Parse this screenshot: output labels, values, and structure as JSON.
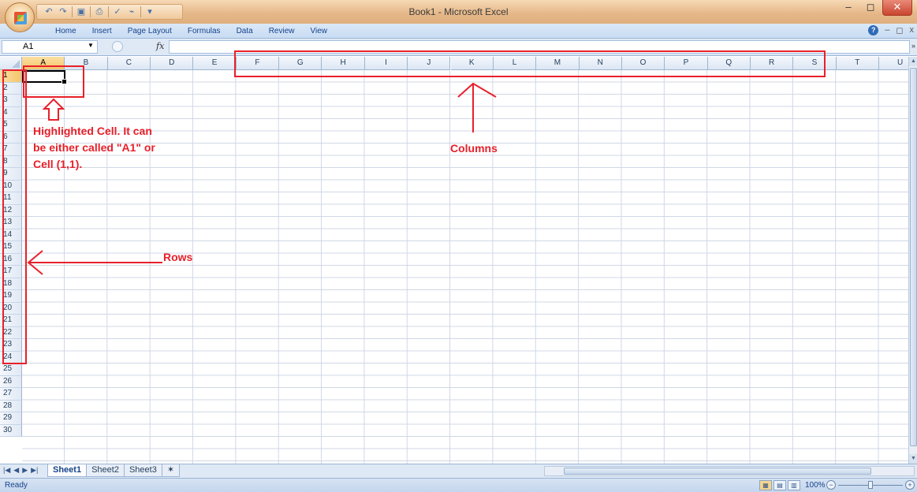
{
  "window": {
    "title": "Book1 - Microsoft Excel",
    "controls": [
      "–",
      "◻",
      "✕"
    ]
  },
  "ribbon": {
    "tabs": [
      "Home",
      "Insert",
      "Page Layout",
      "Formulas",
      "Data",
      "Review",
      "View"
    ],
    "right_controls": [
      "?",
      "–",
      "◻",
      "x"
    ]
  },
  "formula_bar": {
    "name_box": "A1",
    "fx_label": "fx",
    "formula_value": ""
  },
  "grid": {
    "columns": [
      "A",
      "B",
      "C",
      "D",
      "E",
      "F",
      "G",
      "H",
      "I",
      "J",
      "K",
      "L",
      "M",
      "N",
      "O",
      "P",
      "Q",
      "R",
      "S",
      "T",
      "U"
    ],
    "rows": [
      "1",
      "2",
      "3",
      "4",
      "5",
      "6",
      "7",
      "8",
      "9",
      "10",
      "11",
      "12",
      "13",
      "14",
      "15",
      "16",
      "17",
      "18",
      "19",
      "20",
      "21",
      "22",
      "23",
      "24",
      "25",
      "26",
      "27",
      "28",
      "29",
      "30"
    ],
    "active_column": "A",
    "active_row": "1"
  },
  "sheets": {
    "tabs": [
      "Sheet1",
      "Sheet2",
      "Sheet3"
    ],
    "active": "Sheet1"
  },
  "status": {
    "mode": "Ready",
    "zoom": "100%"
  },
  "annotations": {
    "highlighted_cell_note": [
      "Highlighted Cell. It can",
      "be either called \"A1\" or",
      "Cell (1,1)."
    ],
    "columns_label": "Columns",
    "rows_label": "Rows",
    "color": "#e8202a"
  }
}
